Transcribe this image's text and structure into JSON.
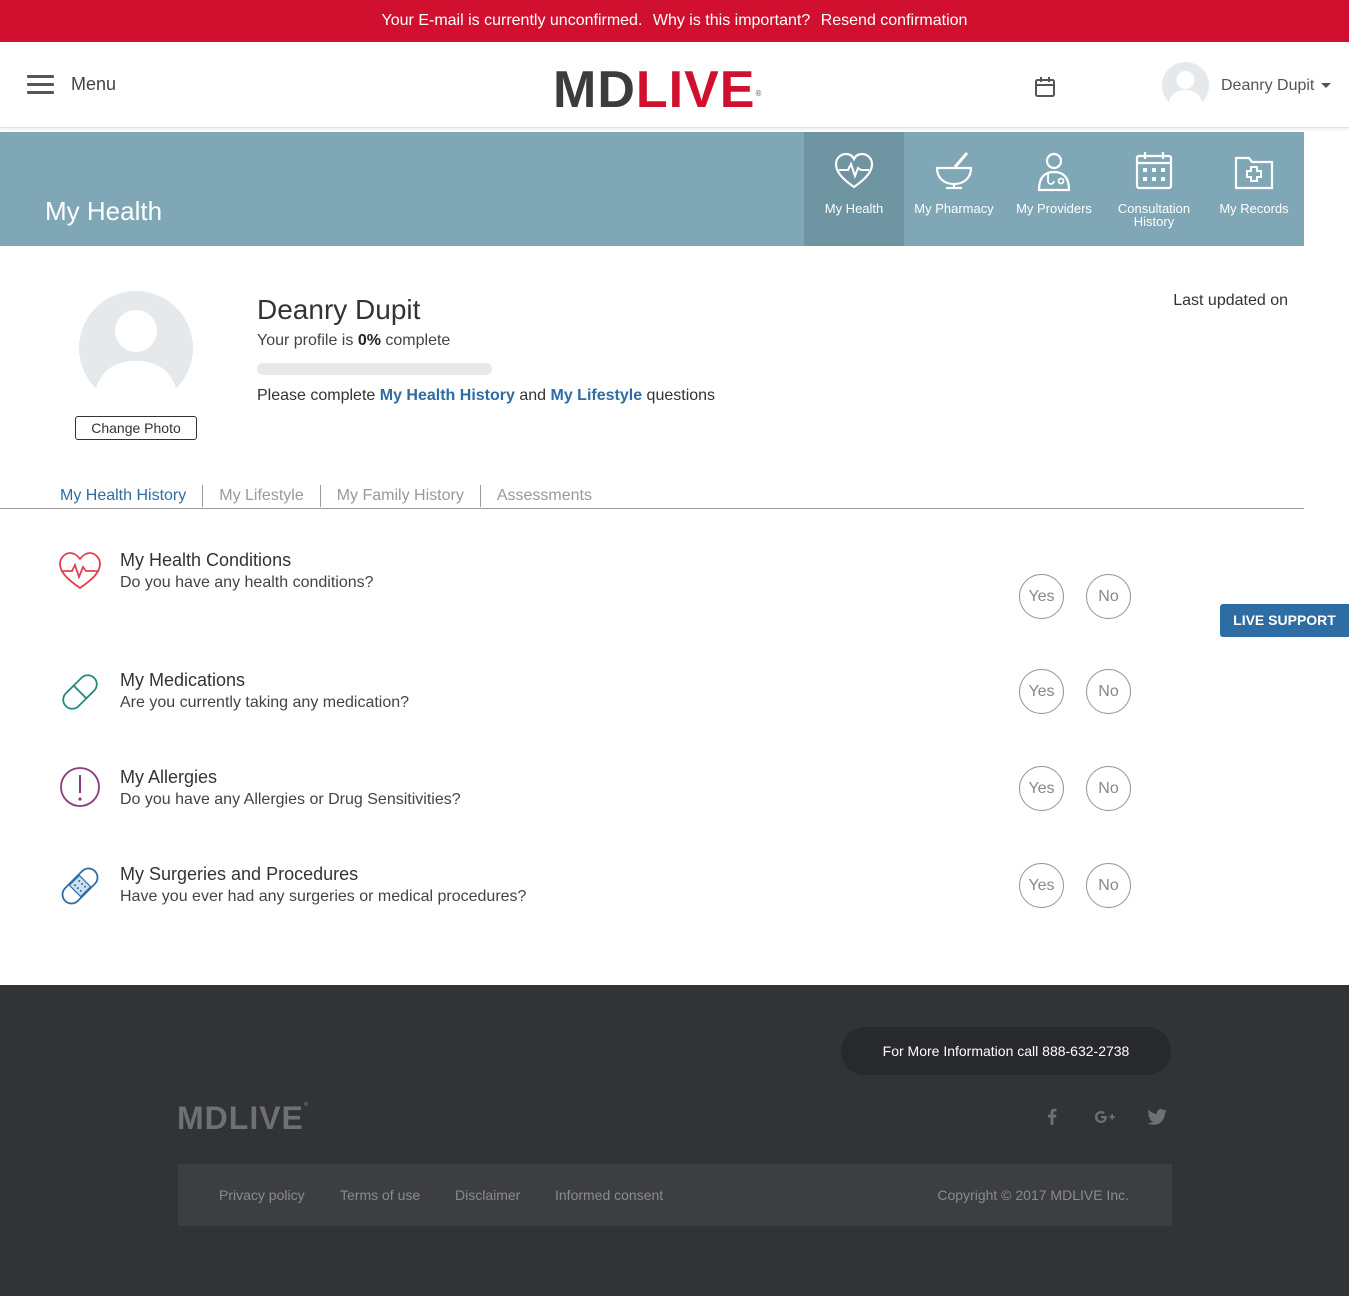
{
  "alert": {
    "message": "Your E-mail is currently unconfirmed.",
    "why_link": "Why is this important?",
    "resend_link": "Resend confirmation",
    "color": "#d0102e"
  },
  "header": {
    "menu_label": "Menu",
    "logo_md": "MD",
    "logo_live": "LIVE",
    "user_name": "Deanry Dupit"
  },
  "band": {
    "title": "My Health",
    "tiles": [
      {
        "label": "My Health",
        "icon": "heart-pulse-icon",
        "active": true
      },
      {
        "label": "My Pharmacy",
        "icon": "mortar-pestle-icon",
        "active": false
      },
      {
        "label": "My Providers",
        "icon": "doctor-icon",
        "active": false
      },
      {
        "label": "Consultation History",
        "icon": "calendar-grid-icon",
        "active": false
      },
      {
        "label": "My Records",
        "icon": "medical-folder-icon",
        "active": false
      }
    ]
  },
  "profile": {
    "name": "Deanry Dupit",
    "complete_prefix": "Your profile is",
    "complete_percent": "0%",
    "complete_suffix": "complete",
    "progress_fraction": 0,
    "prompt_prefix": "Please complete",
    "prompt_link1": "My Health History",
    "prompt_mid": "and",
    "prompt_link2": "My Lifestyle",
    "prompt_suffix": "questions",
    "change_photo": "Change Photo",
    "last_updated": "Last updated on"
  },
  "tabs": [
    {
      "label": "My Health History",
      "active": true
    },
    {
      "label": "My Lifestyle",
      "active": false
    },
    {
      "label": "My Family History",
      "active": false
    },
    {
      "label": "Assessments",
      "active": false
    }
  ],
  "conditions": [
    {
      "title": "My Health Conditions",
      "question": "Do you have any health conditions?",
      "icon": "heart-pulse-icon",
      "color": "#e0424d"
    },
    {
      "title": "My Medications",
      "question": "Are you currently taking any medication?",
      "icon": "pill-icon",
      "color": "#1f8a7e"
    },
    {
      "title": "My Allergies",
      "question": "Do you have any Allergies or Drug Sensitivities?",
      "icon": "exclamation-icon",
      "color": "#8b3a7a"
    },
    {
      "title": "My Surgeries and Procedures",
      "question": "Have you ever had any surgeries or medical procedures?",
      "icon": "bandage-icon",
      "color": "#2e6da4"
    }
  ],
  "answers": {
    "yes": "Yes",
    "no": "No"
  },
  "live_support": "LIVE SUPPORT",
  "footer": {
    "phone": "For More Information call 888-632-2738",
    "logo": "MDLIVE",
    "links": [
      "Privacy policy",
      "Terms of use",
      "Disclaimer",
      "Informed consent"
    ],
    "copyright": "Copyright © 2017 MDLIVE Inc."
  }
}
